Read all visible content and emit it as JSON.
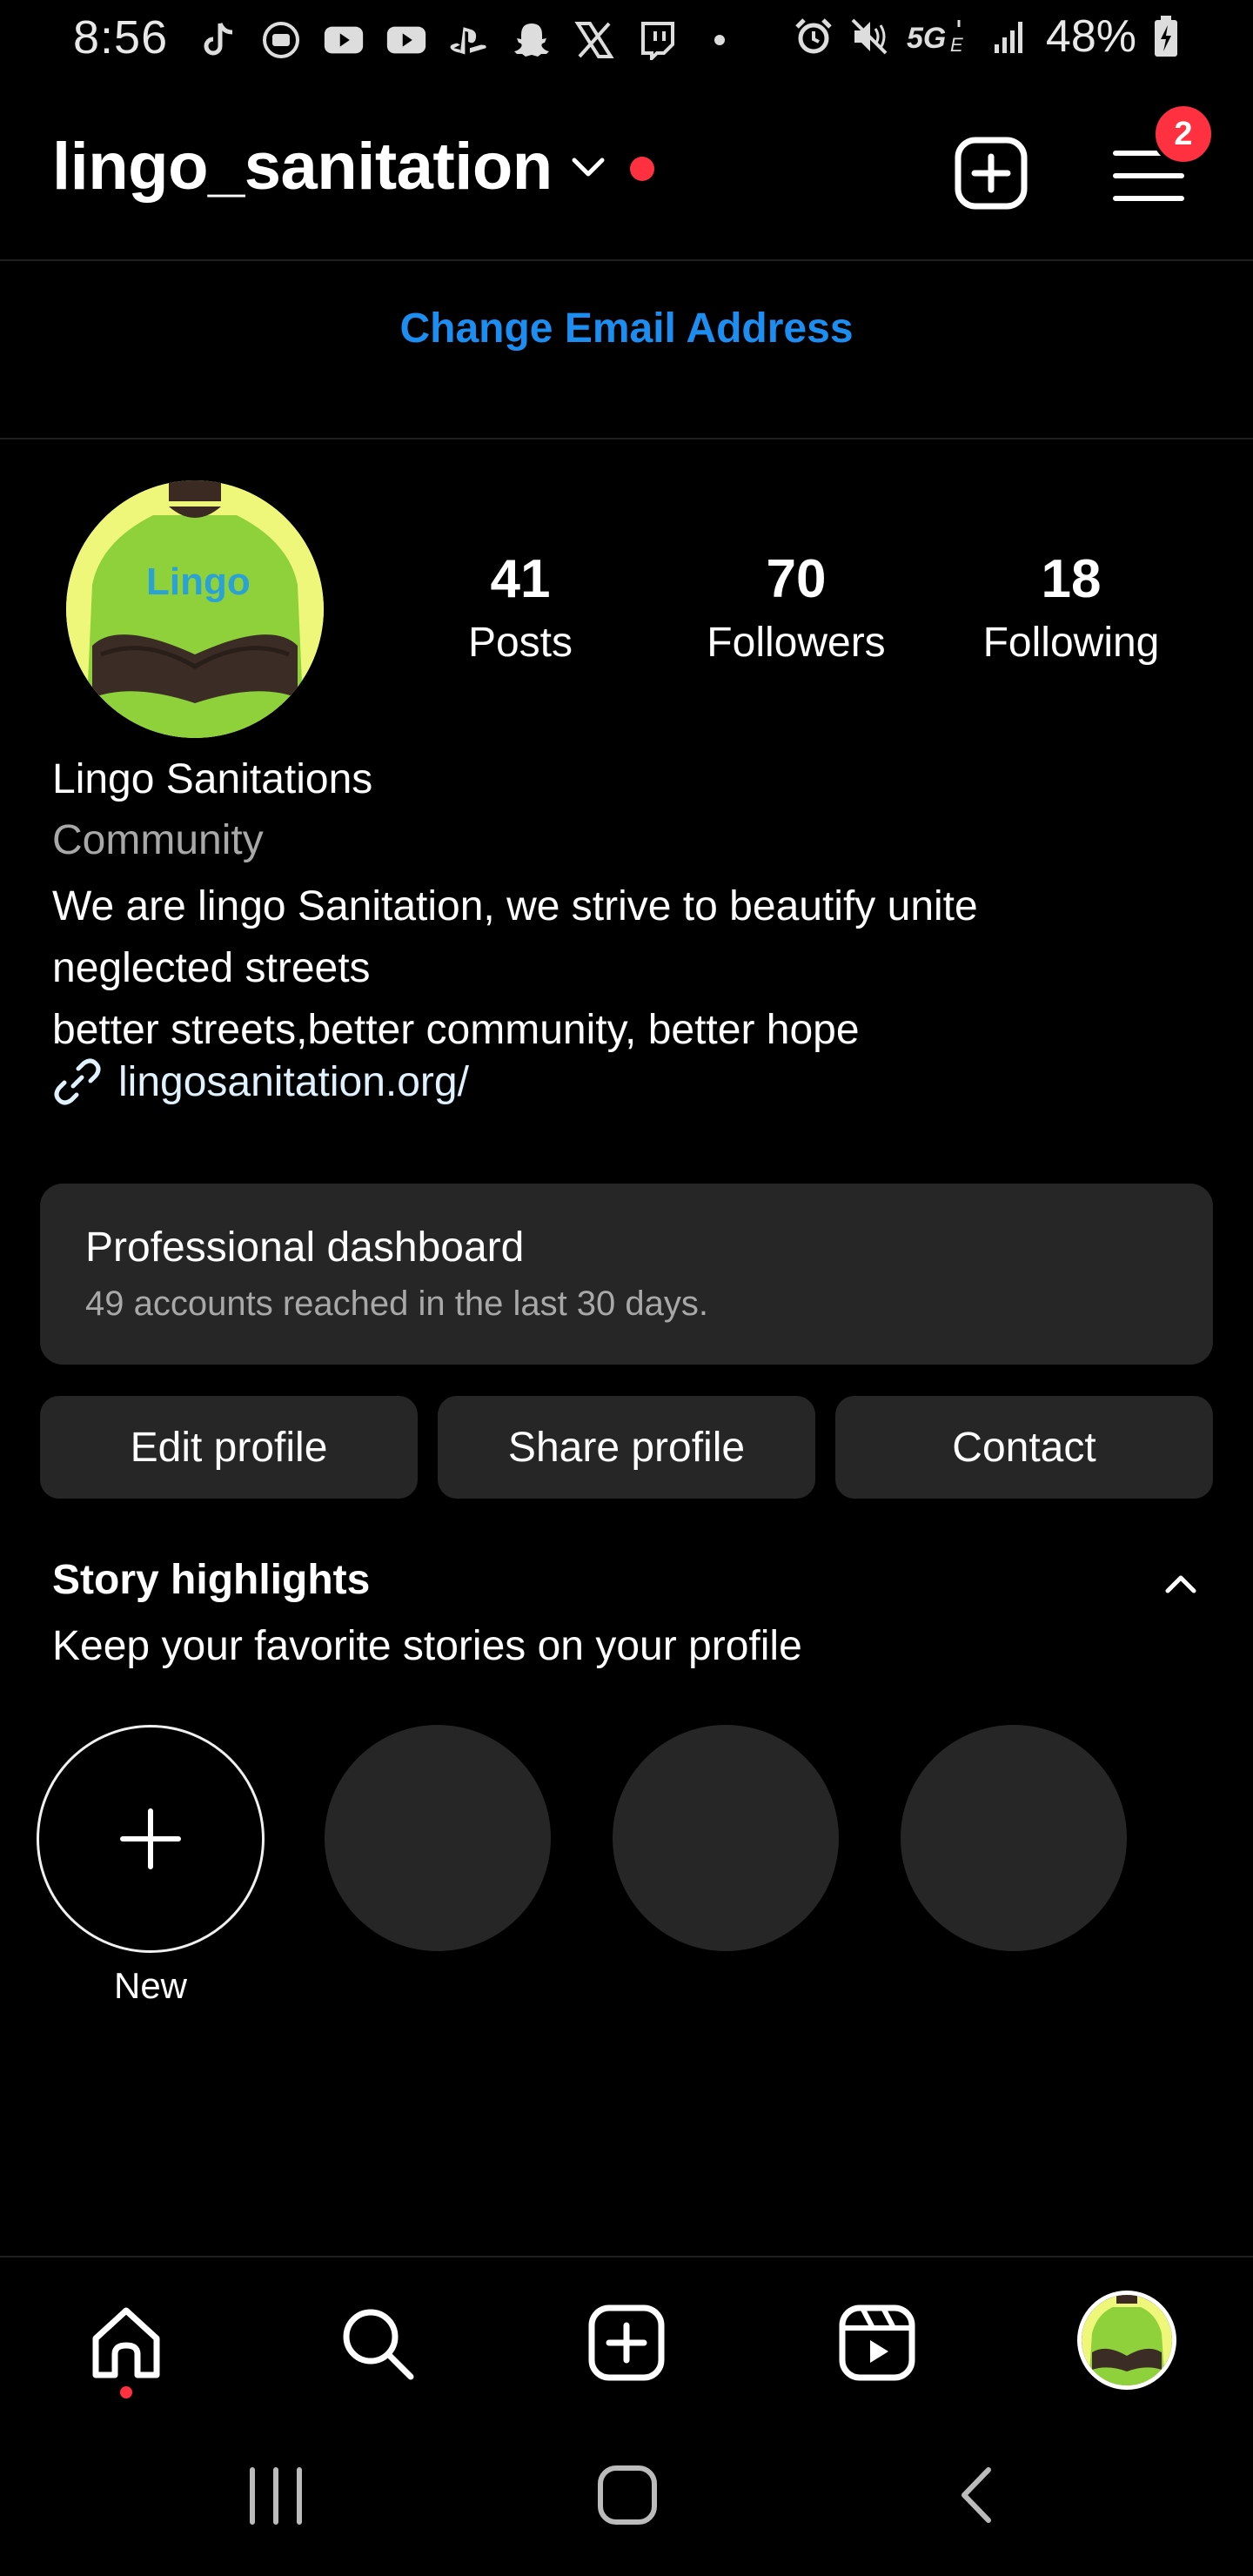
{
  "status_bar": {
    "time": "8:56",
    "battery": "48%",
    "network": "5G",
    "icons": [
      "tiktok-icon",
      "media-icon",
      "youtube-icon",
      "youtube-icon",
      "playstation-icon",
      "snapchat-icon",
      "x-icon",
      "twitch-icon",
      "dot-icon",
      "alarm-icon",
      "mute-icon",
      "5g-icon",
      "signal-icon",
      "battery-icon"
    ]
  },
  "header": {
    "username": "lingo_sanitation",
    "menu_badge": "2"
  },
  "banner": {
    "change_email": "Change Email Address"
  },
  "profile": {
    "stats": [
      {
        "value": "41",
        "label": "Posts"
      },
      {
        "value": "70",
        "label": "Followers"
      },
      {
        "value": "18",
        "label": "Following"
      }
    ],
    "name": "Lingo Sanitations",
    "category": "Community",
    "bio_lines": [
      "We are lingo Sanitation, we strive to beautify unite",
      "neglected streets",
      "better streets,better community, better hope"
    ],
    "link": "lingosanitation.org/",
    "avatar_logo_text": "Lingo"
  },
  "dashboard": {
    "title": "Professional dashboard",
    "subtitle": "49 accounts reached in the last 30 days."
  },
  "actions": {
    "edit": "Edit profile",
    "share": "Share profile",
    "contact": "Contact"
  },
  "highlights": {
    "title": "Story highlights",
    "subtitle": "Keep your favorite stories on your profile",
    "new_label": "New"
  },
  "colors": {
    "accent_blue": "#1c8ef1",
    "notification_red": "#ff3040",
    "surface": "#262626",
    "avatar_green": "#9fdc3c"
  }
}
